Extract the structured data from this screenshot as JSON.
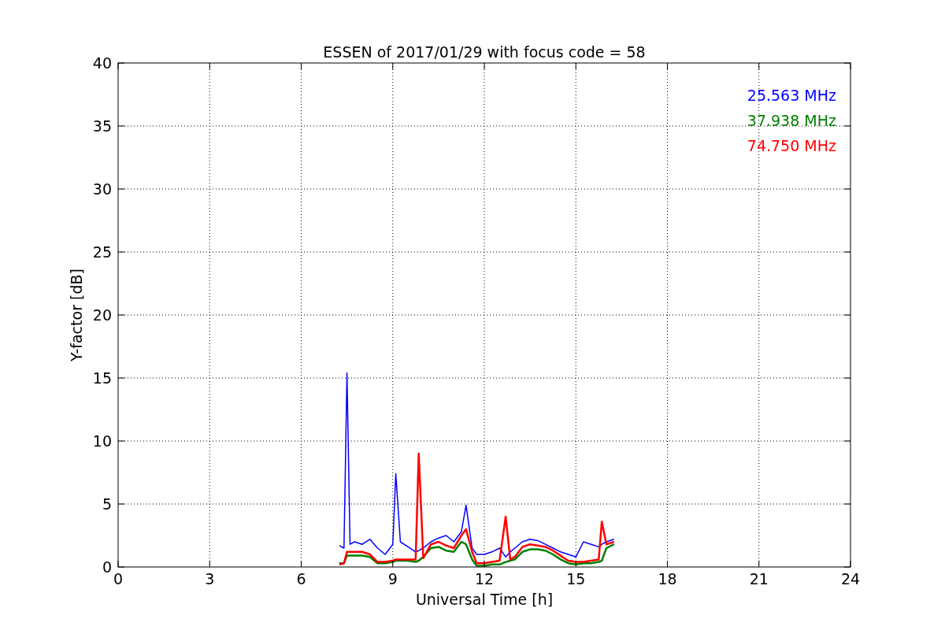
{
  "chart_data": {
    "type": "line",
    "title": "ESSEN of 2017/01/29 with focus code = 58",
    "xlabel": "Universal Time [h]",
    "ylabel": "Y-factor [dB]",
    "x": [
      7.25,
      7.4,
      7.5,
      7.6,
      7.75,
      8,
      8.25,
      8.5,
      8.75,
      9,
      9.1,
      9.25,
      9.5,
      9.75,
      9.85,
      10,
      10.25,
      10.5,
      10.75,
      11,
      11.25,
      11.4,
      11.6,
      11.75,
      12,
      12.25,
      12.5,
      12.7,
      12.85,
      13,
      13.25,
      13.5,
      13.75,
      14,
      14.25,
      14.5,
      14.75,
      15,
      15.25,
      15.5,
      15.75,
      15.85,
      16,
      16.25
    ],
    "series": [
      {
        "name": "25.563 MHz",
        "color": "#0000ff",
        "values": [
          1.7,
          1.5,
          15.4,
          1.8,
          2.0,
          1.8,
          2.2,
          1.5,
          1.0,
          1.8,
          7.4,
          2.0,
          1.6,
          1.2,
          1.3,
          1.5,
          2.0,
          2.3,
          2.5,
          2.0,
          2.8,
          4.9,
          1.5,
          1.0,
          1.0,
          1.2,
          1.5,
          0.8,
          1.2,
          1.5,
          2.0,
          2.2,
          2.1,
          1.8,
          1.5,
          1.2,
          1.0,
          0.8,
          2.0,
          1.8,
          1.6,
          1.8,
          2.0,
          2.2
        ]
      },
      {
        "name": "37.938 MHz",
        "color": "#008000",
        "values": [
          0.3,
          0.3,
          0.9,
          0.9,
          0.9,
          0.9,
          0.8,
          0.3,
          0.3,
          0.4,
          0.5,
          0.5,
          0.5,
          0.4,
          0.5,
          0.8,
          1.5,
          1.6,
          1.3,
          1.2,
          2.0,
          1.8,
          0.6,
          0.1,
          0.1,
          0.2,
          0.2,
          0.4,
          0.5,
          0.6,
          1.2,
          1.4,
          1.4,
          1.3,
          1.0,
          0.6,
          0.3,
          0.2,
          0.3,
          0.3,
          0.4,
          0.5,
          1.5,
          1.8
        ]
      },
      {
        "name": "74.750 MHz",
        "color": "#ff0000",
        "values": [
          0.2,
          0.3,
          1.2,
          1.2,
          1.2,
          1.2,
          1.0,
          0.4,
          0.4,
          0.5,
          0.6,
          0.6,
          0.6,
          0.6,
          9.0,
          0.7,
          1.8,
          2.0,
          1.7,
          1.5,
          2.5,
          3.0,
          1.2,
          0.3,
          0.3,
          0.4,
          0.5,
          4.0,
          0.6,
          0.8,
          1.6,
          1.8,
          1.7,
          1.6,
          1.3,
          0.9,
          0.5,
          0.4,
          0.4,
          0.5,
          0.6,
          3.6,
          1.8,
          2.0
        ]
      }
    ],
    "xlim": [
      0,
      24
    ],
    "ylim": [
      0,
      40
    ],
    "xticks": [
      0,
      3,
      6,
      9,
      12,
      15,
      18,
      21,
      24
    ],
    "yticks": [
      0,
      5,
      10,
      15,
      20,
      25,
      30,
      35,
      40
    ],
    "grid": true
  }
}
